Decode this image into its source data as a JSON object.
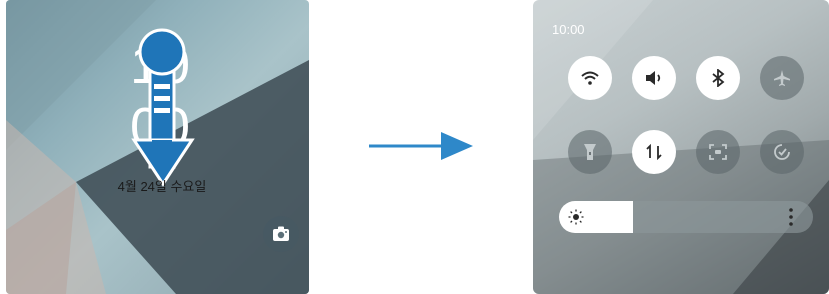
{
  "lock_screen": {
    "clock": {
      "hour_digits": "10",
      "minute_digits": "00"
    },
    "date": "4월 24일 수요일",
    "camera_shortcut_icon": "camera-icon",
    "swipe_indicator": {
      "icon": "swipe-down-finger-icon",
      "color": "#1f75b8"
    }
  },
  "transition_arrow": {
    "icon": "arrow-right-icon",
    "color": "#2e88c9"
  },
  "quick_panel": {
    "time": "10:00",
    "tiles": [
      {
        "id": "wifi",
        "icon": "wifi-icon",
        "state": "on"
      },
      {
        "id": "sound",
        "icon": "sound-icon",
        "state": "on"
      },
      {
        "id": "bluetooth",
        "icon": "bluetooth-icon",
        "state": "on"
      },
      {
        "id": "airplane",
        "icon": "airplane-icon",
        "state": "off"
      },
      {
        "id": "flashlight",
        "icon": "flashlight-icon",
        "state": "off"
      },
      {
        "id": "mobile-data",
        "icon": "mobile-data-icon",
        "state": "on"
      },
      {
        "id": "screen-recorder",
        "icon": "screen-recorder-icon",
        "state": "off"
      },
      {
        "id": "always-on",
        "icon": "check-circle-icon",
        "state": "off"
      }
    ],
    "brightness": {
      "level": 0.29,
      "icon": "sun-icon",
      "more_icon": "more-vertical-icon"
    }
  },
  "colors": {
    "tile_on": "#ffffff",
    "tile_off_icon": "#8a9396",
    "tile_on_icon": "#2a2a2a"
  }
}
